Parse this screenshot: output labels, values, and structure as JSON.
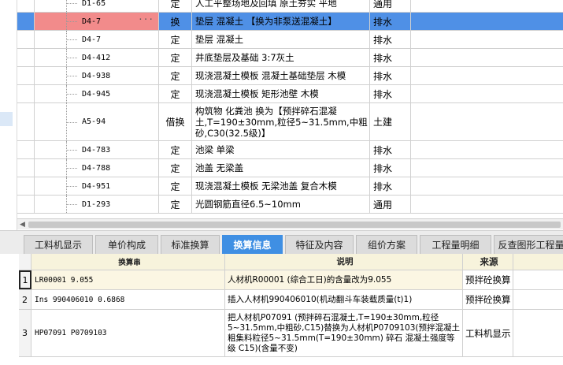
{
  "grid_rows": [
    {
      "code": "D1-65",
      "type": "定",
      "name": "人工平整场地及回填 原土夯实 平地",
      "unit": "通用",
      "selected": false
    },
    {
      "code": "D4-7",
      "type": "换",
      "name": "垫层 混凝土 【换为非泵送混凝土】",
      "unit": "排水",
      "selected": true,
      "menu": "···"
    },
    {
      "code": "D4-7",
      "type": "定",
      "name": "垫层 混凝土",
      "unit": "排水",
      "selected": false
    },
    {
      "code": "D4-412",
      "type": "定",
      "name": "井底垫层及基础 3:7灰土",
      "unit": "排水",
      "selected": false
    },
    {
      "code": "D4-938",
      "type": "定",
      "name": "现浇混凝土模板 混凝土基础垫层 木模",
      "unit": "排水",
      "selected": false
    },
    {
      "code": "D4-945",
      "type": "定",
      "name": "现浇混凝土模板 矩形池壁 木模",
      "unit": "排水",
      "selected": false
    },
    {
      "code": "A5-94",
      "type": "借换",
      "name": "构筑物 化粪池  换为【预拌碎石混凝土,T=190±30mm,粒径5~31.5mm,中粗砂,C30(32.5级)】",
      "unit": "土建",
      "selected": false
    },
    {
      "code": "D4-783",
      "type": "定",
      "name": "池梁 单梁",
      "unit": "排水",
      "selected": false
    },
    {
      "code": "D4-788",
      "type": "定",
      "name": "池盖 无梁盖",
      "unit": "排水",
      "selected": false
    },
    {
      "code": "D4-951",
      "type": "定",
      "name": "现浇混凝土模板 无梁池盖 复合木模",
      "unit": "排水",
      "selected": false
    },
    {
      "code": "D1-293",
      "type": "定",
      "name": "光圆钢筋直径6.5~10mm",
      "unit": "通用",
      "selected": false
    }
  ],
  "tabs": [
    {
      "label": "工料机显示",
      "active": false
    },
    {
      "label": "单价构成",
      "active": false
    },
    {
      "label": "标准换算",
      "active": false
    },
    {
      "label": "换算信息",
      "active": true
    },
    {
      "label": "特征及内容",
      "active": false
    },
    {
      "label": "组价方案",
      "active": false
    },
    {
      "label": "工程量明细",
      "active": false
    },
    {
      "label": "反查图形工程量",
      "active": false
    }
  ],
  "lower_table": {
    "headers": {
      "expr": "换算串",
      "desc": "说明",
      "src": "来源"
    },
    "rows": [
      {
        "num": "1",
        "expr": "LR00001 9.055",
        "desc": "人材机R00001 (综合工日)的含量改为9.055",
        "src": "预拌砼换算"
      },
      {
        "num": "2",
        "expr": "Ins 990406010 0.6868",
        "desc": "插入人材机990406010(机动翻斗车装载质量(t)1)",
        "src": "预拌砼换算"
      },
      {
        "num": "3",
        "expr": "HP07091 P0709103",
        "desc": "把人材机P07091 (预拌碎石混凝土,T=190±30mm,粒径5~31.5mm,中粗砂,C15)替换为人材机P0709103(预拌混凝土 粗集料粒径5~31.5mm(T=190±30mm) 碎石 混凝土强度等级 C15)(含量不变)",
        "src": "工料机显示"
      }
    ]
  },
  "colors": {
    "selected_row": "#4f90e6",
    "selected_code": "#f28b8b",
    "active_tab": "#3f8fe3",
    "header_bg": "#f7f3dc"
  }
}
